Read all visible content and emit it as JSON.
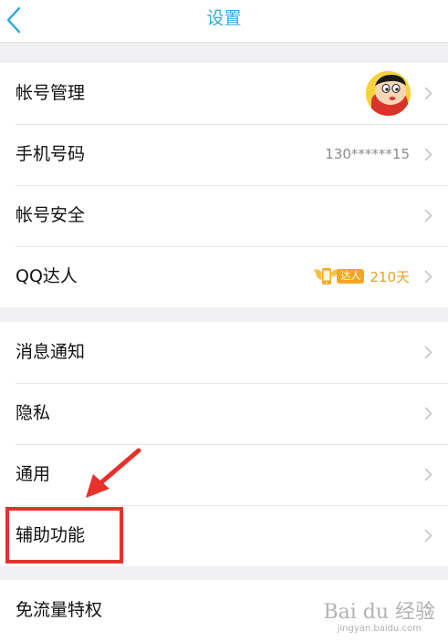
{
  "nav": {
    "title": "设置",
    "title_color": "#33aadf"
  },
  "group1": [
    {
      "label": "帐号管理"
    },
    {
      "label": "手机号码",
      "value": "130******15"
    },
    {
      "label": "帐号安全"
    },
    {
      "label": "QQ达人",
      "badge": "达人",
      "days": "210天"
    }
  ],
  "group2": [
    {
      "label": "消息通知"
    },
    {
      "label": "隐私"
    },
    {
      "label": "通用"
    },
    {
      "label": "辅助功能"
    }
  ],
  "group3": [
    {
      "label": "免流量特权"
    }
  ],
  "watermark": {
    "logo": "Bai du 经验",
    "url": "jingyan.baidu.com"
  },
  "colors": {
    "highlight": "#e8312a",
    "chevron": "#c4c4c8",
    "badge": "#f5a623"
  }
}
